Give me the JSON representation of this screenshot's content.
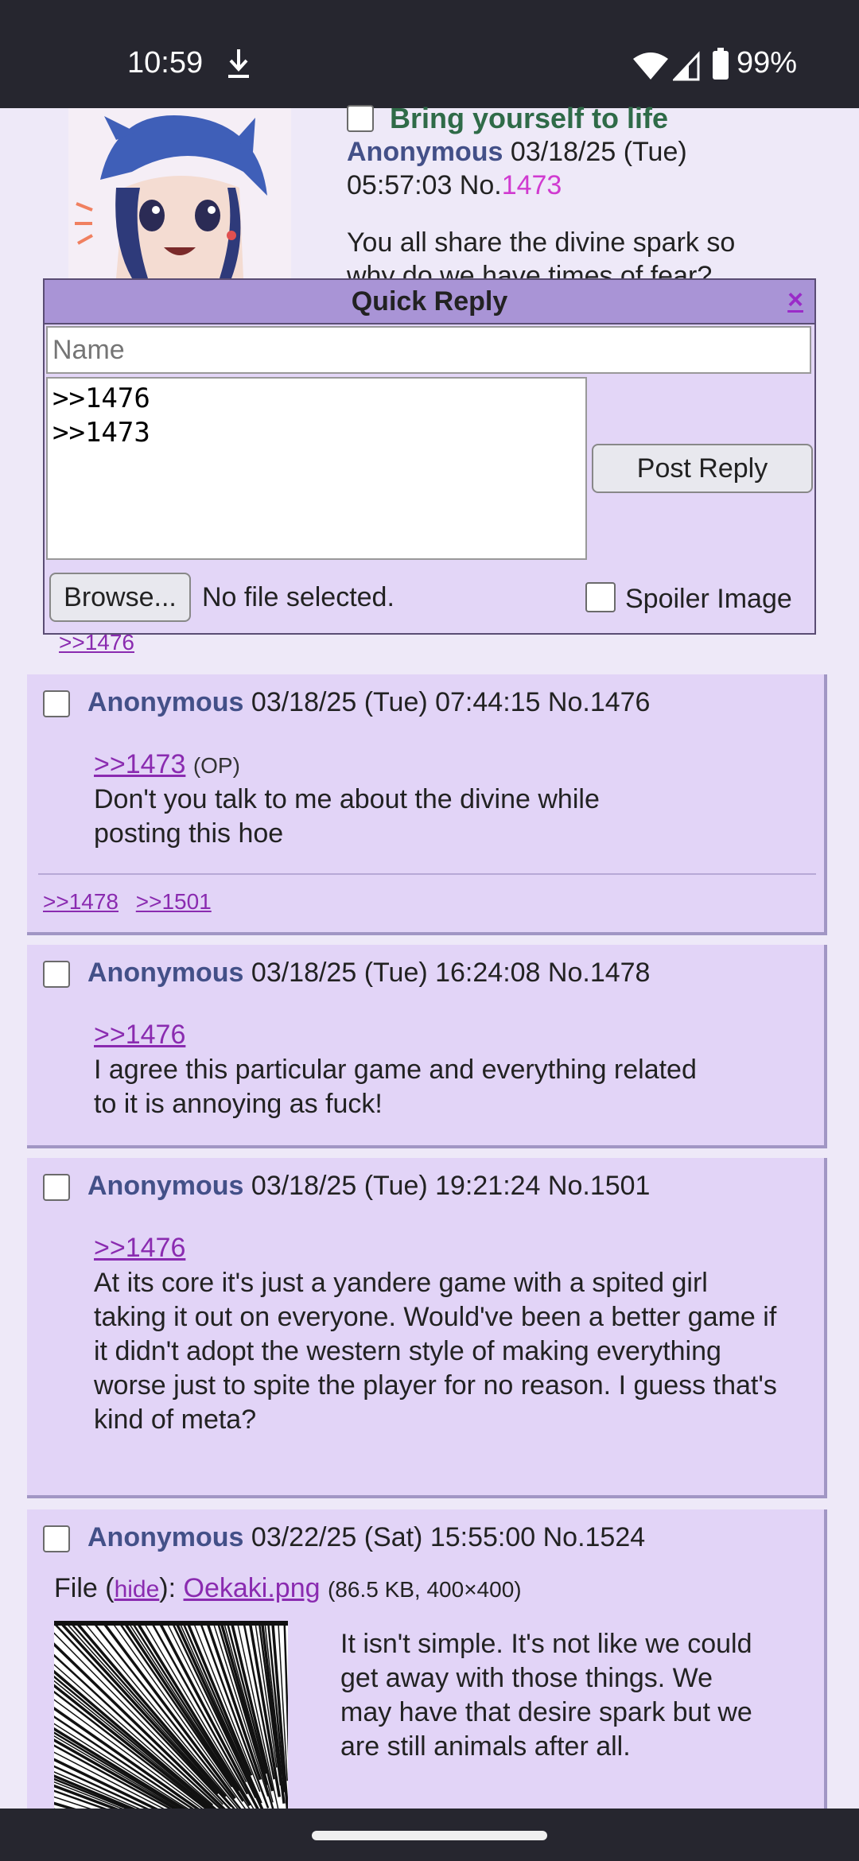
{
  "status_bar": {
    "time": "10:59",
    "battery": "99%"
  },
  "op_post": {
    "subject": "Bring yourself to life",
    "name": "Anonymous",
    "datetime_line1": "03/18/25 (Tue)",
    "datetime_line2": "05:57:03 No.",
    "post_no": "1473",
    "body_line1": "You all share the divine spark so",
    "body_line2": "why do we have times of fear?",
    "backlink": ">>1476"
  },
  "quick_reply": {
    "title": "Quick Reply",
    "close": "×",
    "name_placeholder": "Name",
    "comment_value": ">>1476\n>>1473",
    "post_button": "Post Reply",
    "browse_button": "Browse...",
    "file_status": "No file selected.",
    "spoiler_label": "Spoiler Image"
  },
  "replies": [
    {
      "name": "Anonymous",
      "meta": "03/18/25 (Tue) 07:44:15 No.1476",
      "quote": ">>1473",
      "quote_suffix": "(OP)",
      "text": "Don't you talk to me about the divine while posting this hoe",
      "backlinks": [
        ">>1478",
        ">>1501"
      ]
    },
    {
      "name": "Anonymous",
      "meta": "03/18/25 (Tue) 16:24:08 No.1478",
      "quote": ">>1476",
      "text": "I agree this particular game and everything related to it is annoying as fuck!"
    },
    {
      "name": "Anonymous",
      "meta": "03/18/25 (Tue) 19:21:24 No.1501",
      "quote": ">>1476",
      "text": "At its core it's just a yandere game with a spited girl taking it out on everyone. Would've been a better game if it didn't adopt the western style of making everything worse just to spite the player for no reason. I guess that's kind of meta?"
    },
    {
      "name": "Anonymous",
      "meta": "03/22/25 (Sat) 15:55:00 No.1524",
      "file_label": "File (",
      "file_hide": "hide",
      "file_after": "):",
      "file_name": "Oekaki.png",
      "file_info": "(86.5 KB, 400×400)",
      "text": "It isn't simple. It's not like we could get away with those things. We may have that desire spark but we are still animals after all."
    }
  ],
  "colors": {
    "status_bar_bg": "#26262f",
    "page_bg": "#eee9f8",
    "reply_bg": "#e2d4f7",
    "qr_titlebar": "#a994d6",
    "name_color": "#435088",
    "subject_color": "#2f6b48",
    "link_color": "#8a2bb0",
    "post_no_color": "#d03ad0"
  }
}
